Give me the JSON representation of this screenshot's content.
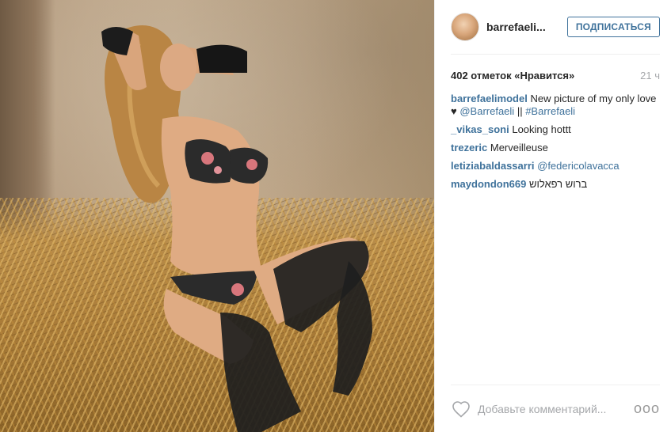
{
  "post": {
    "username": "barrefaeli...",
    "follow_label": "ПОДПИСАТЬСЯ",
    "likes": "402 отметок «Нравится»",
    "time": "21 ч",
    "comment_placeholder": "Добавьте комментарий...",
    "more_label": "ooo",
    "comments": [
      {
        "author": "barrefaelimodel",
        "text": "New picture of my only love",
        "heart": "♥",
        "mention": "@Barrefaeli",
        "sep": "||",
        "tag": "#Barrefaeli"
      },
      {
        "author": "_vikas_soni",
        "text": "Looking hottt"
      },
      {
        "author": "trezeric",
        "text": "Merveilleuse"
      },
      {
        "author": "letiziabaldassarri",
        "mention": "@federicolavacca"
      },
      {
        "author": "maydondon669",
        "text": "ברוש רפאלוש"
      }
    ]
  },
  "icons": {
    "heart": "heart-outline-icon",
    "more": "ellipsis-icon"
  },
  "colors": {
    "link": "#3f729b",
    "text": "#262626",
    "muted": "#a5a7aa",
    "divider": "#efefef"
  }
}
